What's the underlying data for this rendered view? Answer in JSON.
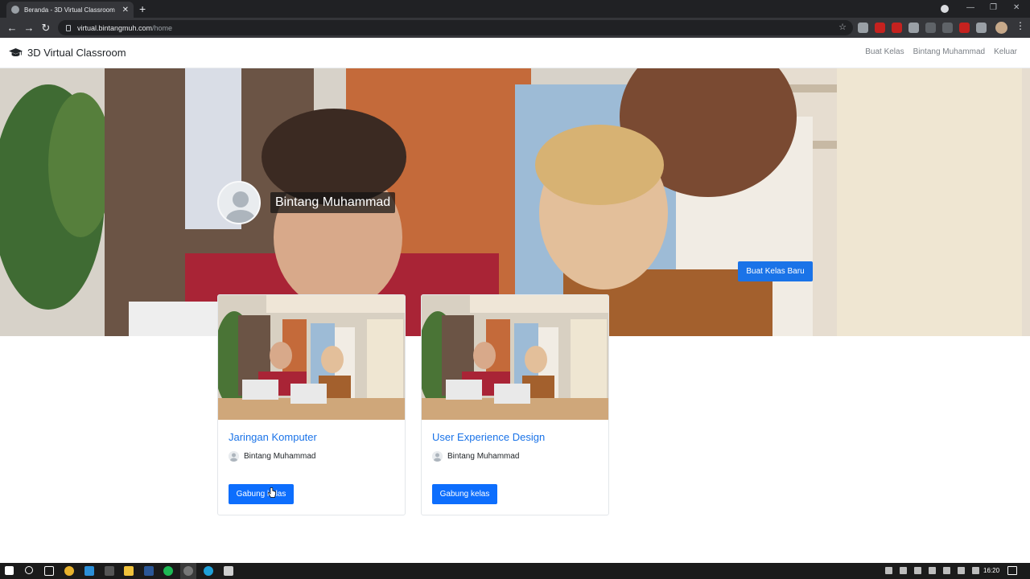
{
  "browser": {
    "tab_title": "Beranda - 3D Virtual Classroom",
    "url_host": "virtual.bintangmuh.com",
    "url_path": "/home"
  },
  "navbar": {
    "brand": "3D Virtual Classroom",
    "links": [
      "Buat Kelas",
      "Bintang Muhammad",
      "Keluar"
    ]
  },
  "hero": {
    "user_name": "Bintang Muhammad",
    "create_button": "Buat Kelas Baru"
  },
  "classes": [
    {
      "title": "Jaringan Komputer",
      "teacher": "Bintang Muhammad",
      "button": "Gabung kelas"
    },
    {
      "title": "User Experience Design",
      "teacher": "Bintang Muhammad",
      "button": "Gabung kelas"
    }
  ],
  "taskbar": {
    "clock": "16:20"
  },
  "colors": {
    "primary": "#0d6efd",
    "link": "#1a73e8",
    "browser_dark": "#202124"
  }
}
